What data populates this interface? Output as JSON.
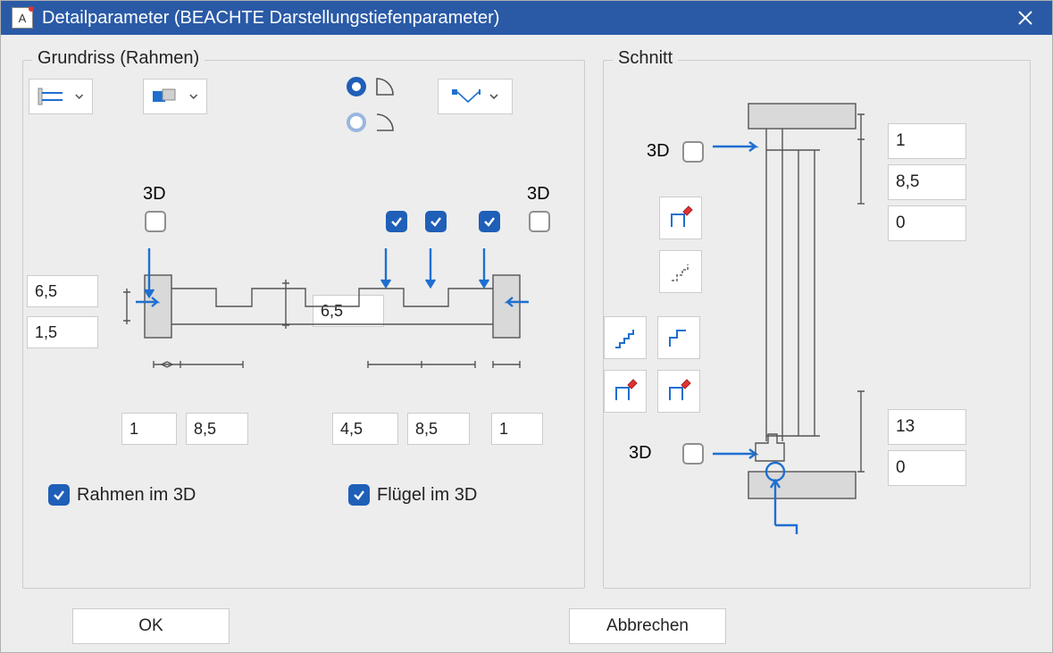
{
  "window": {
    "title": "Detailparameter (BEACHTE Darstellungstiefenparameter)"
  },
  "groups": {
    "plan": "Grundriss (Rahmen)",
    "section": "Schnitt"
  },
  "plan": {
    "label3d_left": "3D",
    "label3d_right": "3D",
    "input_a": "6,5",
    "input_b": "1,5",
    "input_center": "6,5",
    "row": {
      "v1": "1",
      "v2": "8,5",
      "v3": "4,5",
      "v4": "8,5",
      "v5": "1"
    },
    "chk_frame": "Rahmen im 3D",
    "chk_sash": "Flügel im 3D"
  },
  "section": {
    "label3d_top": "3D",
    "label3d_bottom": "3D",
    "v1": "1",
    "v2": "8,5",
    "v3": "0",
    "v4": "13",
    "v5": "0"
  },
  "buttons": {
    "ok": "OK",
    "cancel": "Abbrechen"
  },
  "chart_data": {
    "type": "table",
    "description": "Dialog numeric parameters for frame and section detail representation",
    "plan_values": {
      "frame_outer": 6.5,
      "frame_inner": 1.5,
      "sash_center": 6.5,
      "bottom": [
        1,
        8.5,
        4.5,
        8.5,
        1
      ]
    },
    "section_values": {
      "top": [
        1,
        8.5,
        0
      ],
      "bottom": [
        13,
        0
      ]
    }
  }
}
